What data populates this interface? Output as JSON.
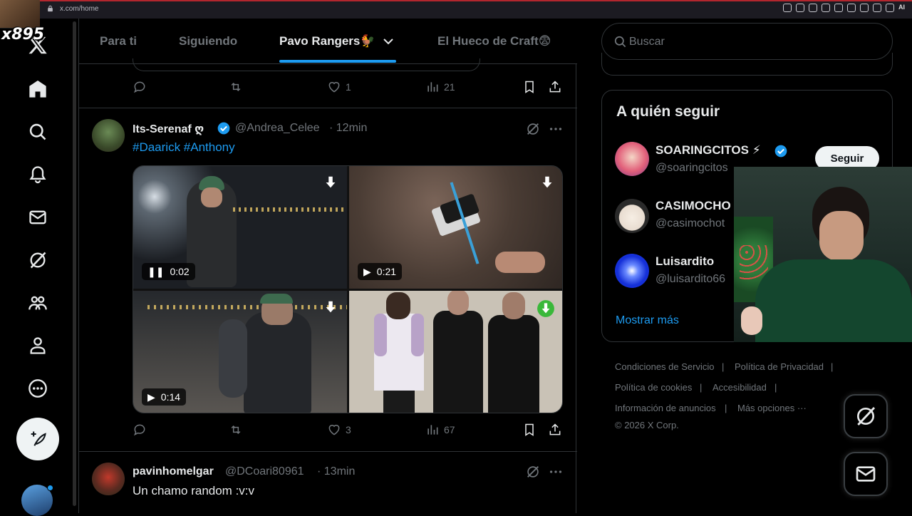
{
  "browser": {
    "url": "x.com/home",
    "ai_label": "AI"
  },
  "stream_overlay": {
    "badge": "x895"
  },
  "nav": {
    "items": [
      "x-logo",
      "home",
      "explore",
      "notifications",
      "messages",
      "grok",
      "communities",
      "profile",
      "more"
    ]
  },
  "tabs": [
    {
      "label": "Para ti",
      "active": false
    },
    {
      "label": "Siguiendo",
      "active": false
    },
    {
      "label": "Pavo Rangers🐓",
      "active": true
    },
    {
      "label": "El Hueco de Craft😨",
      "active": false
    }
  ],
  "prev_post_actions": {
    "replies": "",
    "reposts": "",
    "likes": "1",
    "views": "21"
  },
  "post1": {
    "name": "Its-Serenaf ღ",
    "handle": "@Andrea_Celee",
    "time": "· 12min",
    "hashtags": "#Daarick #Anthony",
    "videos": [
      {
        "time": "0:02",
        "state": "playing"
      },
      {
        "time": "0:21",
        "state": "paused"
      },
      {
        "time": "0:14",
        "state": "paused"
      }
    ],
    "actions": {
      "likes": "3",
      "views": "67"
    }
  },
  "post2": {
    "name": "pavinhomelgar",
    "handle": "@DCoari80961",
    "time": "· 13min",
    "text": "Un chamo random :v:v"
  },
  "search": {
    "placeholder": "Buscar"
  },
  "who_to_follow": {
    "title": "A quién seguir",
    "users": [
      {
        "name": "SOARINGCITOS ⚡",
        "handle": "@soaringcitos",
        "verified": true
      },
      {
        "name": "CASIMOCHO",
        "handle": "@casimochot",
        "verified": false
      },
      {
        "name": "Luisardito",
        "handle": "@luisardito66",
        "verified": false
      }
    ],
    "follow_label": "Seguir",
    "show_more": "Mostrar más"
  },
  "footer": {
    "links": [
      "Condiciones de Servicio",
      "Política de Privacidad",
      "Política de cookies",
      "Accesibilidad",
      "Información de anuncios",
      "Más opciones ···"
    ],
    "copyright": "© 2026 X Corp."
  },
  "colors": {
    "accent": "#1d9bf0",
    "text": "#e7e9ea",
    "muted": "#71767b",
    "border": "#2f3336",
    "verified": "#1d9bf0"
  }
}
